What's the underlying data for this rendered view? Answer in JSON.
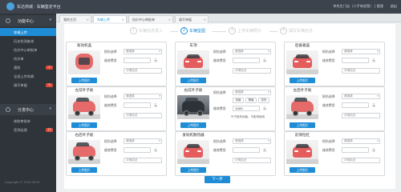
{
  "app": {
    "name": "车达商城 · 车辆鉴定平台",
    "user": "李先生门店（二手车经营） | 管理",
    "logout": "退出"
  },
  "sidebar": {
    "groups": [
      {
        "label": "功能中心",
        "items": [
          {
            "label": "车辆上传",
            "active": true,
            "badge": ""
          },
          {
            "label": "历史检测查询",
            "badge": ""
          },
          {
            "label": "估价中心审批单",
            "badge": ""
          },
          {
            "label": "估价单",
            "badge": ""
          },
          {
            "label": "通知",
            "badge": "2"
          },
          {
            "label": "全部上传车辆",
            "badge": ""
          },
          {
            "label": "填写单据",
            "badge": "9"
          }
        ]
      },
      {
        "label": "分发中心",
        "items": [
          {
            "label": "收取审批单",
            "badge": ""
          },
          {
            "label": "签到处理",
            "badge": "17"
          }
        ]
      }
    ],
    "copyright": "Copyright © 2015-2016"
  },
  "tabs": [
    {
      "label": "我的主页"
    },
    {
      "label": "车辆上传",
      "active": true
    },
    {
      "label": "估价中心审批单"
    },
    {
      "label": "填写单据"
    }
  ],
  "steps": [
    {
      "num": "1",
      "label": "车辆信息录入"
    },
    {
      "num": "2",
      "label": "车辆鉴图",
      "active": true
    },
    {
      "num": "3",
      "label": "上传车辆照片"
    },
    {
      "num": "4",
      "label": "填写车辆信息"
    }
  ],
  "form_labels": {
    "damage": "损伤选择",
    "cost": "维修费用",
    "note_placeholder": "详情描述",
    "select_placeholder": "请选择",
    "unit": "元",
    "upload": "上传照片"
  },
  "cards": [
    {
      "title": "发动机盖"
    },
    {
      "title": "车顶"
    },
    {
      "title": "后备箱盖"
    },
    {
      "title": "左前叶子板"
    },
    {
      "title": "右前叶子板",
      "tags": [
        "划痕",
        "擦痕",
        "变形"
      ],
      "cost": "1000",
      "note": "叶子板有划痕，不影响使用"
    },
    {
      "title": "左后叶子板"
    },
    {
      "title": "右后叶子板"
    },
    {
      "title": "发动机散热器"
    },
    {
      "title": "前保险杠"
    }
  ],
  "next_button": "下一步",
  "colors": {
    "primary": "#1f8dd6",
    "sidebar": "#2f343b",
    "topbar": "#3d434c",
    "badge": "#e04b3a"
  }
}
